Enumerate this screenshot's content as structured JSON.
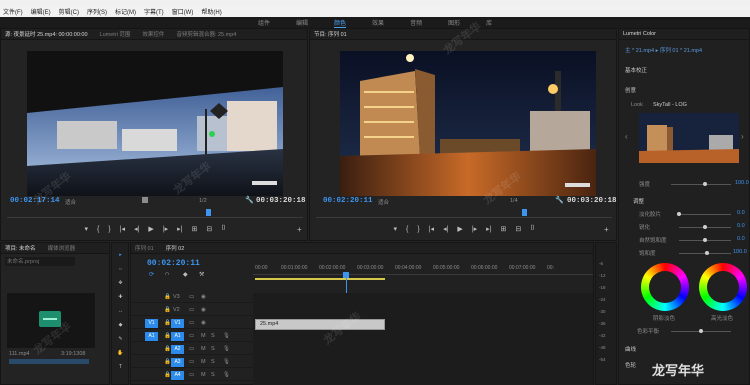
{
  "menu": [
    "文件(F)",
    "编辑(E)",
    "剪辑(C)",
    "序列(S)",
    "标记(M)",
    "字幕(T)",
    "窗口(W)",
    "帮助(H)"
  ],
  "workspaces": [
    "组件",
    "编辑",
    "颜色",
    "效果",
    "音频",
    "图形",
    "库"
  ],
  "workspace_active_index": 2,
  "source": {
    "tabs": [
      "源: 夜景延时 25.mp4: 00:00:00:00",
      "Lumetri 范围",
      "效果控件",
      "音频剪辑混合器: 25.mp4"
    ],
    "left_tc": "00:02:17:14",
    "fit": "适合",
    "page": "1/2",
    "right_tc": "00:03:20:18",
    "controls": [
      "▾",
      "{",
      "}",
      "|◂",
      "◂|",
      "▶",
      "|▸",
      "▸|",
      "⊞",
      "⊟",
      "⌷"
    ]
  },
  "program": {
    "tabs": [
      "节目: 序列 01"
    ],
    "left_tc": "00:02:20:11",
    "fit": "适合",
    "page": "1/4",
    "right_tc": "00:03:20:18",
    "controls": [
      "▾",
      "{",
      "}",
      "|◂",
      "◂|",
      "▶",
      "|▸",
      "▸|",
      "⊞",
      "⊟",
      "⌷"
    ]
  },
  "lumetri": {
    "tab": "Lumetri Color",
    "breadcrumb": "主 * 21.mp4 ▸ 序列 01 * 21.mp4",
    "section": "基本校正",
    "creative": "创意",
    "look_label": "Look",
    "look_value": "SkyTall - LOG",
    "sliders": [
      {
        "label": "强度",
        "value": "100.0"
      },
      {
        "label": "调整",
        "value": ""
      },
      {
        "label": "淡化胶片",
        "value": "0.0"
      },
      {
        "label": "锐化",
        "value": "0.0"
      },
      {
        "label": "自然饱和度",
        "value": "0.0"
      },
      {
        "label": "饱和度",
        "value": "100.0"
      }
    ],
    "wheels": [
      "阴影淡色",
      "高光淡色"
    ],
    "balance_label": "色彩平衡",
    "curve_label": "曲线",
    "wheel_label": "色轮"
  },
  "project": {
    "tabs": [
      "项目: 未命名",
      "媒体浏览器"
    ],
    "search_placeholder": "未命名.prproj",
    "clip_name": "111.mp4",
    "clip_duration": "3:19:1308"
  },
  "timeline": {
    "tabs": [
      "序列 01",
      "序列 02"
    ],
    "timecode": "00:02:20:11",
    "ruler": [
      "00:00",
      "00:01:00:00",
      "00:02:00:00",
      "00:03:00:00",
      "00:04:00:00",
      "00:05:00:00",
      "00:06:00:00",
      "00:07:00:00",
      "00:"
    ],
    "video_tracks": [
      "V3",
      "V2",
      "V1"
    ],
    "audio_tracks": [
      "A1",
      "A2",
      "A3",
      "A4"
    ],
    "source_patch": [
      "V1",
      "A1"
    ],
    "clip_label": "25.mp4",
    "tools": [
      "▸",
      "⇔",
      "✥",
      "✚",
      "↔",
      "◆",
      "✎",
      "✋",
      "T"
    ]
  },
  "meter_labels": [
    "-6",
    "-12",
    "-18",
    "-24",
    "-30",
    "-36",
    "-42",
    "-48",
    "-54"
  ],
  "watermark_text": "龙写年华",
  "colors": {
    "accent": "#2d8ceb",
    "timeline_clip": "#c8c8c8"
  }
}
